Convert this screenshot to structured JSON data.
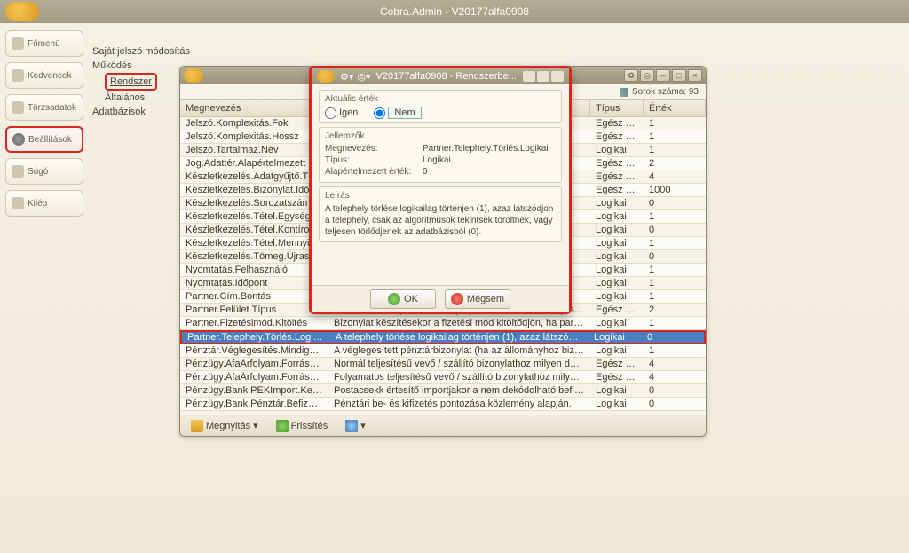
{
  "app": {
    "title": "Cobra.Admin - V20177alfa0908"
  },
  "sidebar": {
    "items": [
      {
        "label": "Főmenü",
        "icon": "home-icon"
      },
      {
        "label": "Kedvencek",
        "icon": "star-icon"
      },
      {
        "label": "Törzsadatok",
        "icon": "list-icon"
      },
      {
        "label": "Beállítások",
        "icon": "gear-icon"
      },
      {
        "label": "Súgó",
        "icon": "help-icon"
      },
      {
        "label": "Kilép",
        "icon": "exit-icon"
      }
    ]
  },
  "tree": {
    "n0": "Saját jelszó módosítás",
    "n1": "Működés",
    "n1a": "Rendszer",
    "n1b": "Általános",
    "n2": "Adatbázisok"
  },
  "grid": {
    "row_count_label": "Sorok száma: 93",
    "headers": {
      "c1": "Megnevezés",
      "c2": "",
      "c3": "Típus",
      "c4": "Érték"
    },
    "rows": [
      {
        "n": "Jelszó.Komplexitás.Fok",
        "d": "",
        "t": "Egész szám",
        "v": "1"
      },
      {
        "n": "Jelszó.Komplexitás.Hossz",
        "d": "",
        "t": "Egész szám",
        "v": "1"
      },
      {
        "n": "Jelszó.Tartalmaz.Név",
        "d": "",
        "t": "Logikai",
        "v": "1"
      },
      {
        "n": "Jog.Adattér.Alapértelmezett",
        "d": "",
        "t": "Egész szám",
        "v": "2"
      },
      {
        "n": "Készletkezelés.Adatgyűjtő.Típus",
        "d": "",
        "t": "Egész szám",
        "v": "4"
      },
      {
        "n": "Készletkezelés.Bizonylat.Időtúllépés",
        "d": "",
        "t": "Egész szám",
        "v": "1000"
      },
      {
        "n": "Készletkezelés.SorozatszámBrow...",
        "d": "",
        "t": "Logikai",
        "v": "0"
      },
      {
        "n": "Készletkezelés.Tétel.Egységár.F...",
        "d": "",
        "t": "Logikai",
        "v": "1"
      },
      {
        "n": "Készletkezelés.Tétel.Kontírozás.E...",
        "d": "",
        "t": "Logikai",
        "v": "0"
      },
      {
        "n": "Készletkezelés.Tétel.Mennyiség....",
        "d": "",
        "t": "Logikai",
        "v": "1"
      },
      {
        "n": "Készletkezelés.Tömeg.Újraszámít...",
        "d": "",
        "t": "Logikai",
        "v": "0"
      },
      {
        "n": "Nyomtatás.Felhasználó",
        "d": "",
        "t": "Logikai",
        "v": "1"
      },
      {
        "n": "Nyomtatás.Időpont",
        "d": "",
        "t": "Logikai",
        "v": "1"
      },
      {
        "n": "Partner.Cím.Bontás",
        "d": "",
        "t": "Logikai",
        "v": "1"
      },
      {
        "n": "Partner.Felület.Típus",
        "d": "Az alkalmazott partner dialog típusa. Az 1 érték az egyszerűsített...",
        "t": "Egész szám",
        "v": "2"
      },
      {
        "n": "Partner.Fizetésimód.Kitöltés",
        "d": "Bizonylat készítésekor a fizetési mód kitöltődjön, ha partnert tallózunk a partnernél me...",
        "t": "Logikai",
        "v": "1"
      },
      {
        "n": "Partner.Telephely.Törlés.Logikai",
        "d": "A telephely törlése logikailag történjen (1), azaz látszódjon a telephely, csak az algor...",
        "t": "Logikai",
        "v": "0"
      },
      {
        "n": "Pénztár.Véglegesítés.MindigMent...",
        "d": "A véglegesített pénztárbizonylat (ha az állományhoz bizonylatszám generálás van be...",
        "t": "Logikai",
        "v": "1"
      },
      {
        "n": "Pénzügy.ÁfaÁrfolyam.ForrásDát...",
        "d": "Normál teljesítésű vevő / szállító bizonylathoz milyen dátum alapján kínáljon fel ÁFA á...",
        "t": "Egész szám",
        "v": "4"
      },
      {
        "n": "Pénzügy.ÁfaÁrfolyam.ForrásDát...",
        "d": "Folyamatos teljesítésű vevő / szállító bizonylathoz milyen dátum alapján kínáljon fel Á...",
        "t": "Egész szám",
        "v": "4"
      },
      {
        "n": "Pénzügy.Bank.PEKImport.Keresé...",
        "d": "Postacsekk értesítő importjakor a nem dekódolható befizetőazonosítókat keresve tenü...",
        "t": "Logikai",
        "v": "0"
      },
      {
        "n": "Pénzügy.Bank.Pénztár.Befizetés....",
        "d": "Pénztári be- és kifizetés pontozása közlemény alapján.",
        "t": "Logikai",
        "v": "0"
      }
    ],
    "selected_index": 16,
    "toolbar": {
      "open": "Megnyitás",
      "refresh": "Frissítés"
    }
  },
  "dialog": {
    "title": "V20177alfa0908 - Rendszerbe...",
    "group_actual": "Aktuális érték",
    "radio_yes": "Igen",
    "radio_no": "Nem",
    "radio_value": "no",
    "group_props": "Jellemzők",
    "prop_name_label": "Megnevezés:",
    "prop_name_value": "Partner.Telephely.Törlés.Logikai",
    "prop_type_label": "Típus:",
    "prop_type_value": "Logikai",
    "prop_default_label": "Alapértelmezett érték:",
    "prop_default_value": "0",
    "group_desc": "Leírás",
    "desc_text": "A telephely törlése logikailag történjen (1), azaz látszódjon a telephely, csak az algoritmusok tekintsék töröltnek, vagy teljesen törlődjenek az adatbázisból (0).",
    "btn_ok": "OK",
    "btn_cancel": "Mégsem"
  }
}
